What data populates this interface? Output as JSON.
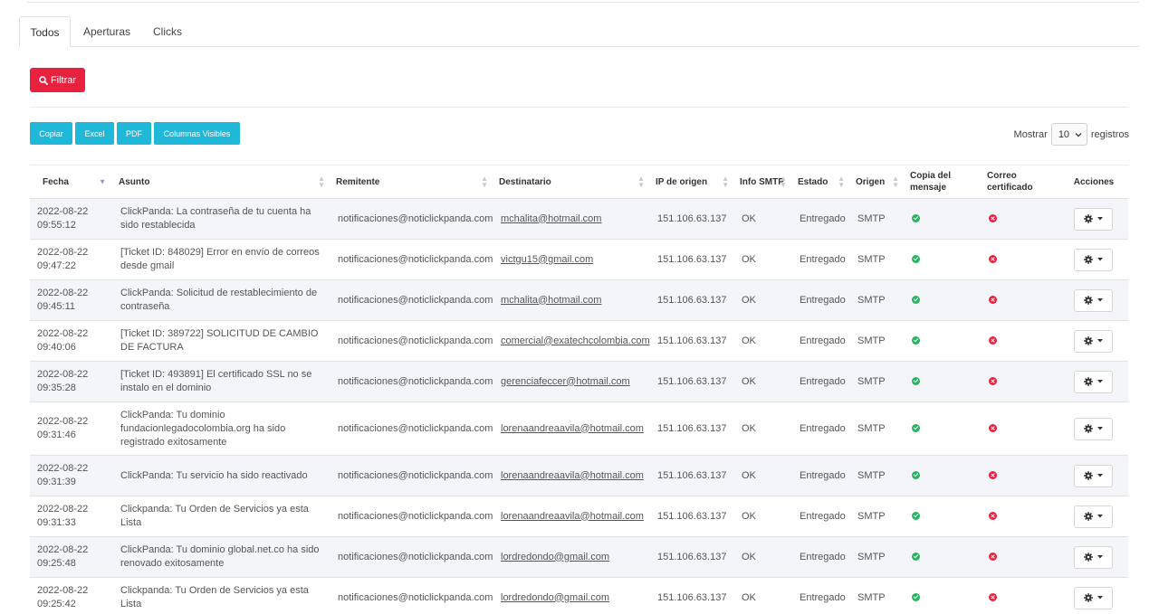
{
  "tabs": [
    {
      "label": "Todos",
      "active": true
    },
    {
      "label": "Aperturas",
      "active": false
    },
    {
      "label": "Clicks",
      "active": false
    }
  ],
  "filter_button": {
    "label": "Filtrar",
    "icon": "search-icon",
    "color": "#e8213f"
  },
  "export_buttons": [
    {
      "label": "Copiar"
    },
    {
      "label": "Excel"
    },
    {
      "label": "PDF"
    },
    {
      "label": "Columnas Visibles"
    }
  ],
  "export_color": "#1fb8d9",
  "length_control": {
    "prefix": "Mostrar",
    "selected": "10",
    "suffix": "registros"
  },
  "table": {
    "columns": [
      {
        "label": "Fecha",
        "sorted": "desc"
      },
      {
        "label": "Asunto",
        "sorted": "none"
      },
      {
        "label": "Remitente",
        "sorted": "none"
      },
      {
        "label": "Destinatario",
        "sorted": "none"
      },
      {
        "label": "IP de origen",
        "sorted": "none"
      },
      {
        "label": "Info SMTP",
        "sorted": "none"
      },
      {
        "label": "Estado",
        "sorted": "none"
      },
      {
        "label": "Origen",
        "sorted": "none"
      },
      {
        "label": "Copia del mensaje",
        "sorted": "none"
      },
      {
        "label": "Correo certificado",
        "sorted": "none"
      },
      {
        "label": "Acciones",
        "sorted": "none"
      }
    ],
    "rows": [
      {
        "fecha": "2022-08-22",
        "hora": "09:55:12",
        "asunto": "ClickPanda: La contraseña de tu cuenta ha sido restablecida",
        "remitente": "notificaciones@noticlickpanda.com",
        "destinatario": "mchalita@hotmail.com",
        "ip": "151.106.63.137",
        "info": "OK",
        "estado": "Entregado",
        "origen": "SMTP",
        "copia": true,
        "certificado": false,
        "lines": 2
      },
      {
        "fecha": "2022-08-22",
        "hora": "09:47:22",
        "asunto": "[Ticket ID: 848029] Error en envío de correos desde gmail",
        "remitente": "notificaciones@noticlickpanda.com",
        "destinatario": "victgu15@gmail.com",
        "ip": "151.106.63.137",
        "info": "OK",
        "estado": "Entregado",
        "origen": "SMTP",
        "copia": true,
        "certificado": false,
        "lines": 2
      },
      {
        "fecha": "2022-08-22",
        "hora": "09:45:11",
        "asunto": "ClickPanda: Solicitud de restablecimiento de contraseña",
        "remitente": "notificaciones@noticlickpanda.com",
        "destinatario": "mchalita@hotmail.com",
        "ip": "151.106.63.137",
        "info": "OK",
        "estado": "Entregado",
        "origen": "SMTP",
        "copia": true,
        "certificado": false,
        "lines": 2
      },
      {
        "fecha": "2022-08-22",
        "hora": "09:40:06",
        "asunto": "[Ticket ID: 389722] SOLICITUD DE CAMBIO DE FACTURA",
        "remitente": "notificaciones@noticlickpanda.com",
        "destinatario": "comercial@exatechcolombia.com",
        "ip": "151.106.63.137",
        "info": "OK",
        "estado": "Entregado",
        "origen": "SMTP",
        "copia": true,
        "certificado": false,
        "lines": 2
      },
      {
        "fecha": "2022-08-22",
        "hora": "09:35:28",
        "asunto": "[Ticket ID: 493891] El certificado SSL no se instalo en el dominio",
        "remitente": "notificaciones@noticlickpanda.com",
        "destinatario": "gerenciafeccer@hotmail.com",
        "ip": "151.106.63.137",
        "info": "OK",
        "estado": "Entregado",
        "origen": "SMTP",
        "copia": true,
        "certificado": false,
        "lines": 2
      },
      {
        "fecha": "2022-08-22",
        "hora": "09:31:46",
        "asunto": "ClickPanda: Tu dominio fundacionlegadocolombia.org ha sido registrado exitosamente",
        "remitente": "notificaciones@noticlickpanda.com",
        "destinatario": "lorenaandreaavila@hotmail.com",
        "ip": "151.106.63.137",
        "info": "OK",
        "estado": "Entregado",
        "origen": "SMTP",
        "copia": true,
        "certificado": false,
        "lines": 3
      },
      {
        "fecha": "2022-08-22",
        "hora": "09:31:39",
        "asunto": "ClickPanda: Tu servicio ha sido reactivado",
        "remitente": "notificaciones@noticlickpanda.com",
        "destinatario": "lorenaandreaavila@hotmail.com",
        "ip": "151.106.63.137",
        "info": "OK",
        "estado": "Entregado",
        "origen": "SMTP",
        "copia": true,
        "certificado": false,
        "lines": 2
      },
      {
        "fecha": "2022-08-22",
        "hora": "09:31:33",
        "asunto": "Clickpanda: Tu Orden de Servicios ya esta Lista",
        "remitente": "notificaciones@noticlickpanda.com",
        "destinatario": "lorenaandreaavila@hotmail.com",
        "ip": "151.106.63.137",
        "info": "OK",
        "estado": "Entregado",
        "origen": "SMTP",
        "copia": true,
        "certificado": false,
        "lines": 2
      },
      {
        "fecha": "2022-08-22",
        "hora": "09:25:48",
        "asunto": "ClickPanda: Tu dominio global.net.co ha sido renovado exitosamente",
        "remitente": "notificaciones@noticlickpanda.com",
        "destinatario": "lordredondo@gmail.com",
        "ip": "151.106.63.137",
        "info": "OK",
        "estado": "Entregado",
        "origen": "SMTP",
        "copia": true,
        "certificado": false,
        "lines": 2
      },
      {
        "fecha": "2022-08-22",
        "hora": "09:25:42",
        "asunto": "Clickpanda: Tu Orden de Servicios ya esta Lista",
        "remitente": "notificaciones@noticlickpanda.com",
        "destinatario": "lordredondo@gmail.com",
        "ip": "151.106.63.137",
        "info": "OK",
        "estado": "Entregado",
        "origen": "SMTP",
        "copia": true,
        "certificado": false,
        "lines": 2
      }
    ]
  }
}
